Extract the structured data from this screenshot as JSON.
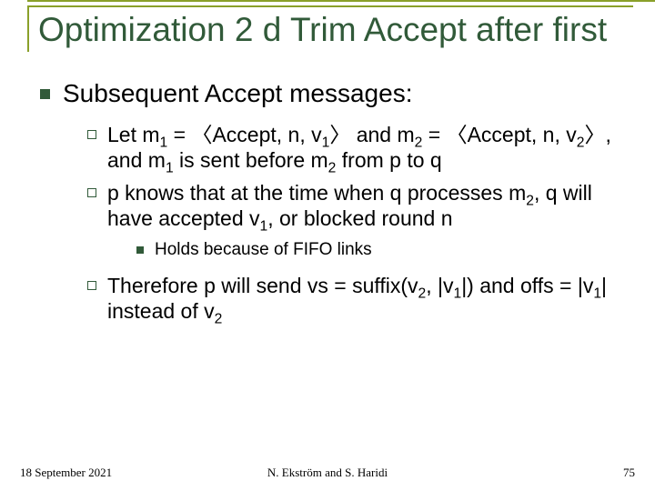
{
  "title": "Optimization 2 d Trim Accept after first",
  "sections": {
    "heading": "Subsequent Accept messages:",
    "bullet1_pre": "Let m",
    "bullet1_mid1": " = 〈Accept, n, v",
    "bullet1_mid2": "〉 and m",
    "bullet1_mid3": " = 〈Accept, n, v",
    "bullet1_mid4": "〉, and m",
    "bullet1_mid5": " is sent before m",
    "bullet1_end": " from p to q",
    "sub1a": "1",
    "sub1b": "1",
    "sub2a": "2",
    "sub2b": "2",
    "sub1c": "1",
    "sub2c": "2",
    "bullet2_pre": "p knows that at the time when q processes m",
    "bullet2_mid1": ", q will have accepted v",
    "bullet2_end": ", or blocked round n",
    "b2s1": "2",
    "b2s2": "1",
    "bullet2_sub": "Holds because of FIFO links",
    "bullet3_pre": "Therefore p will send vs = suffix(v",
    "bullet3_mid1": ", |v",
    "bullet3_mid2": "|) and offs = |v",
    "bullet3_mid3": "| instead of v",
    "b3s1": "2",
    "b3s2": "1",
    "b3s3": "1",
    "b3s4": "2"
  },
  "footer": {
    "date": "18 September 2021",
    "authors": "N. Ekström and S. Haridi",
    "page": "75"
  }
}
